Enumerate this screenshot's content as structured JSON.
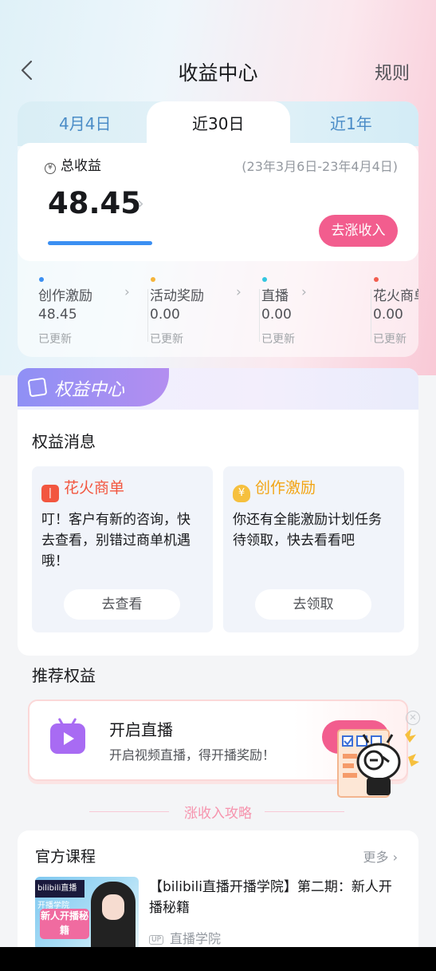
{
  "header": {
    "title": "收益中心",
    "rule_label": "规则"
  },
  "tabs": [
    {
      "label": "4月4日"
    },
    {
      "label": "近30日",
      "active": true
    },
    {
      "label": "近1年"
    }
  ],
  "earnings": {
    "total_label": "总收益",
    "currency_symbol": "¥",
    "date_range": "(23年3月6日-23年4月4日)",
    "amount": "48.45",
    "chevron": "›",
    "boost_button": "去涨收入"
  },
  "categories": [
    {
      "name": "创作激励",
      "value": "48.45",
      "status": "已更新",
      "dot_color": "#3b8ff2"
    },
    {
      "name": "活动奖励",
      "value": "0.00",
      "status": "已更新",
      "dot_color": "#f5b43a"
    },
    {
      "name": "直播",
      "value": "0.00",
      "status": "已更新",
      "dot_color": "#34c6e0"
    },
    {
      "name": "花火商单",
      "value": "0.00",
      "status": "已更新",
      "dot_color": "#f25d4e"
    }
  ],
  "rights": {
    "banner_title": "权益中心",
    "messages_title": "权益消息",
    "messages": [
      {
        "title": "花火商单",
        "text": "叮！客户有新的咨询，快去查看，别错过商单机遇哦！",
        "button": "去查看",
        "color": "#f2563f",
        "icon": "spark-icon"
      },
      {
        "title": "创作激励",
        "text": "你还有全能激励计划任务待领取，快去看看吧",
        "button": "去领取",
        "color": "#f2a515",
        "icon": "money-bag-icon"
      }
    ]
  },
  "recommended": {
    "title": "推荐权益",
    "item": {
      "name": "开启直播",
      "desc": "开启视频直播，得开播奖励！",
      "icon": "tv-icon"
    }
  },
  "strategy_label": "涨收入攻略",
  "courses": {
    "title": "官方课程",
    "more_label": "更多",
    "item": {
      "title": "【bilibili直播开播学院】第二期：新人开播秘籍",
      "uploader": "直播学院",
      "up_tag": "UP",
      "thumb_band": "bilibili直播 开播学院",
      "thumb_text": "新人开播秘籍"
    }
  },
  "colors": {
    "accent_pink": "#f25d8e",
    "accent_blue": "#3b8ff2",
    "rights_purple": "#8f90f5"
  }
}
